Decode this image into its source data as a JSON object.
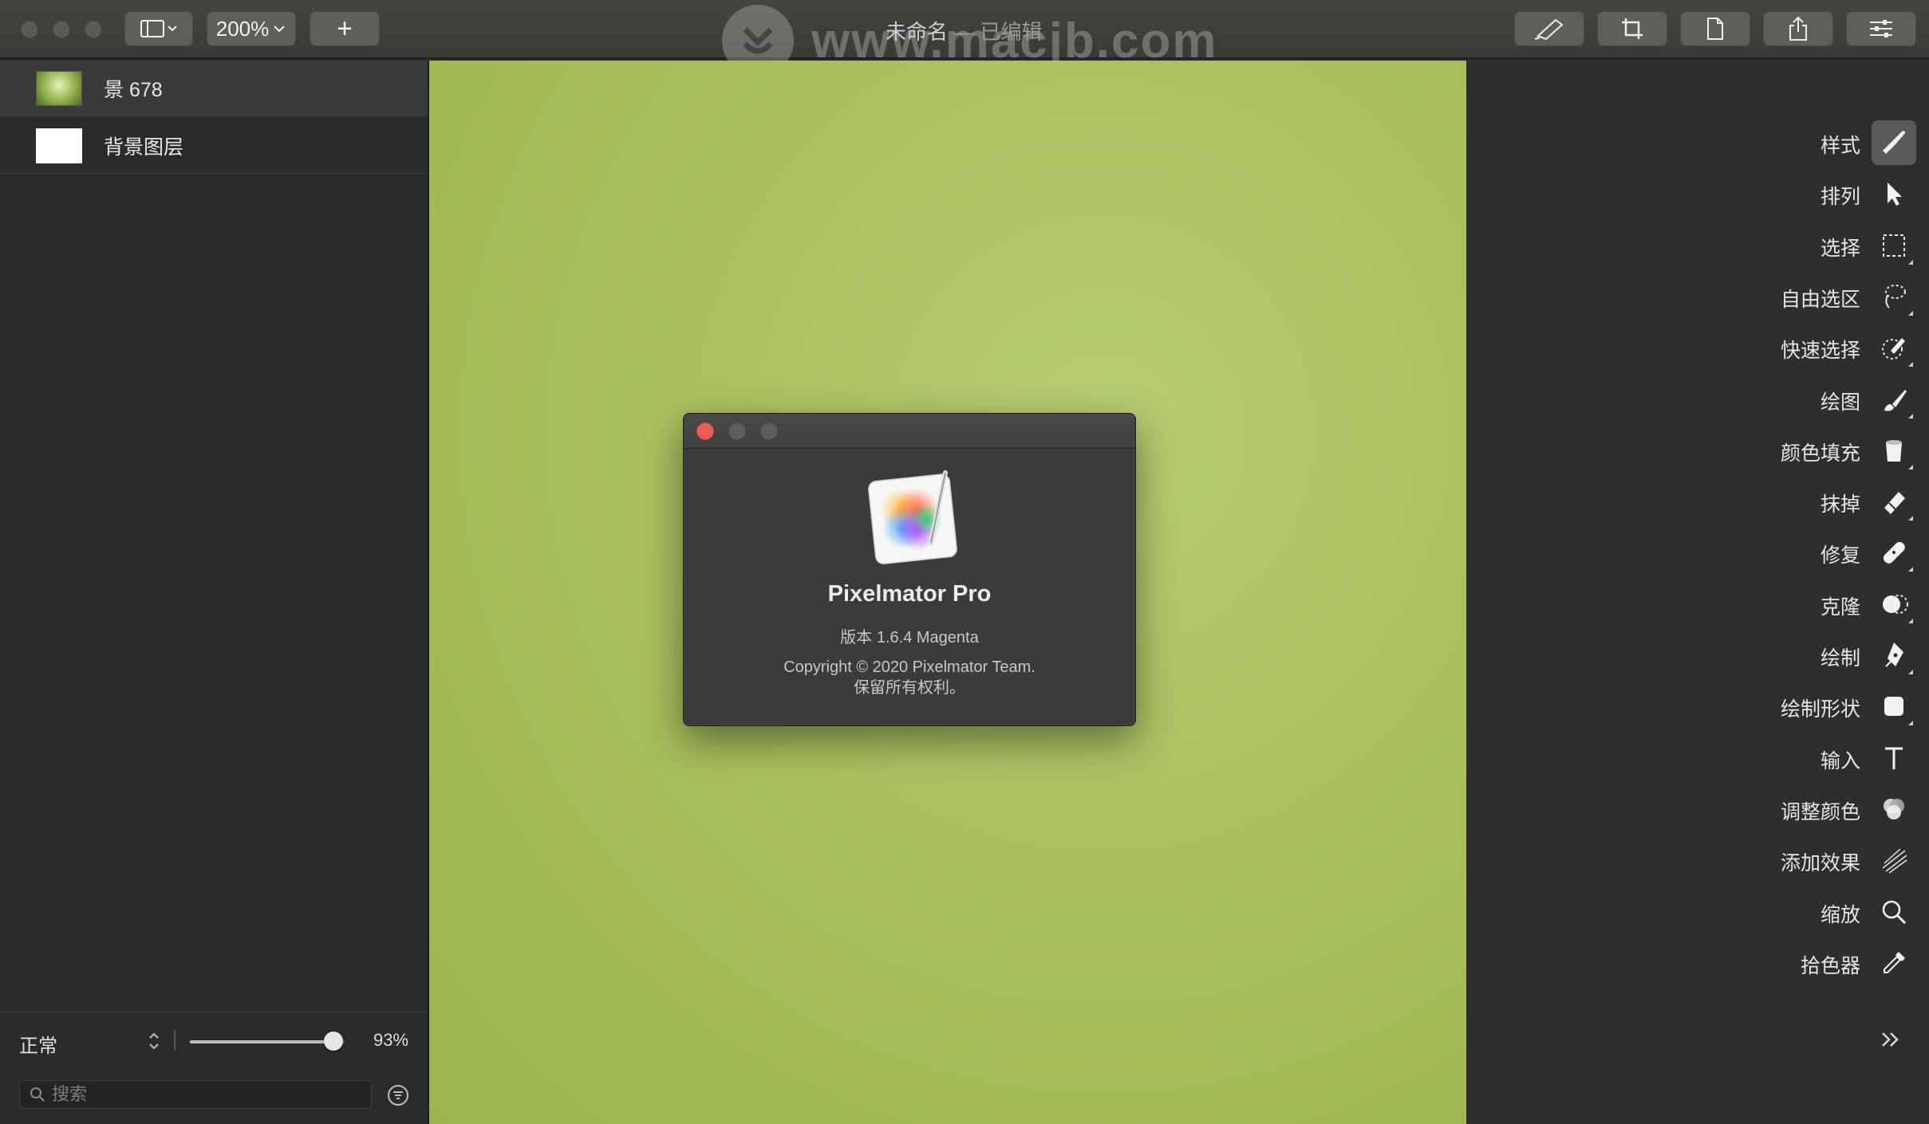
{
  "window": {
    "title": "未命名",
    "title_separator": "—",
    "title_status": "已编辑",
    "watermark": "www.macjb.com"
  },
  "toolbar": {
    "zoom": "200%",
    "add_label": "+"
  },
  "layers": [
    {
      "name": "景 678",
      "selected": true
    },
    {
      "name": "背景图层",
      "selected": false
    }
  ],
  "layer_controls": {
    "blend_mode": "正常",
    "opacity": "93%",
    "opacity_value": 0.93,
    "search_placeholder": "搜索"
  },
  "about": {
    "app_name": "Pixelmator Pro",
    "version": "版本 1.6.4 Magenta",
    "copyright_line1": "Copyright © 2020 Pixelmator Team.",
    "copyright_line2": "保留所有权利。"
  },
  "tools": [
    {
      "label": "样式",
      "icon": "brush-style-icon",
      "active": true
    },
    {
      "label": "排列",
      "icon": "arrow-pointer-icon",
      "active": false
    },
    {
      "label": "选择",
      "icon": "marquee-select-icon",
      "active": false
    },
    {
      "label": "自由选区",
      "icon": "lasso-icon",
      "active": false
    },
    {
      "label": "快速选择",
      "icon": "quick-select-icon",
      "active": false
    },
    {
      "label": "绘图",
      "icon": "paint-brush-icon",
      "active": false
    },
    {
      "label": "颜色填充",
      "icon": "paint-bucket-icon",
      "active": false
    },
    {
      "label": "抹掉",
      "icon": "eraser-icon",
      "active": false
    },
    {
      "label": "修复",
      "icon": "bandage-icon",
      "active": false
    },
    {
      "label": "克隆",
      "icon": "clone-stamp-icon",
      "active": false
    },
    {
      "label": "绘制",
      "icon": "pen-nib-icon",
      "active": false
    },
    {
      "label": "绘制形状",
      "icon": "rounded-square-icon",
      "active": false
    },
    {
      "label": "输入",
      "icon": "text-t-icon",
      "active": false
    },
    {
      "label": "调整颜色",
      "icon": "color-adjust-icon",
      "active": false
    },
    {
      "label": "添加效果",
      "icon": "effects-icon",
      "active": false
    },
    {
      "label": "缩放",
      "icon": "magnifier-icon",
      "active": false
    },
    {
      "label": "拾色器",
      "icon": "eyedropper-icon",
      "active": false
    }
  ],
  "colors": {
    "close_red": "#ec5d57",
    "canvas_green": "#aac05f"
  }
}
